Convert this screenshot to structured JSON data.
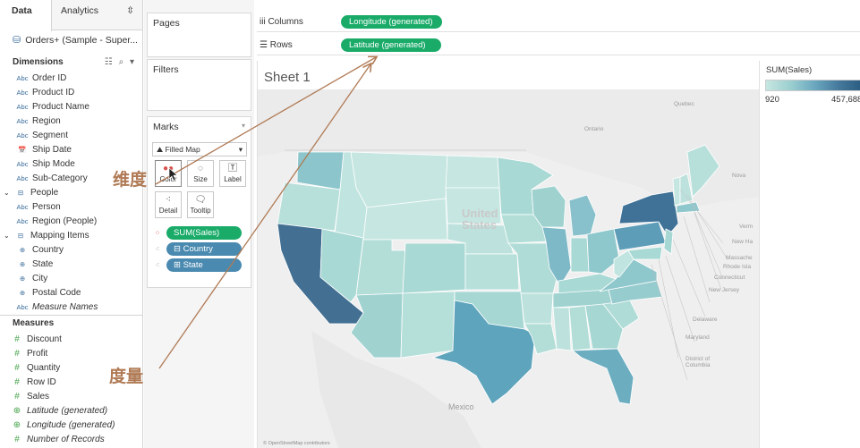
{
  "data_pane": {
    "tab_data": "Data",
    "tab_analytics": "Analytics",
    "tab_analytics_icon": "⇳",
    "datasource": "Orders+ (Sample - Super...",
    "dimensions_header": "Dimensions",
    "dimensions": [
      {
        "icon": "Abc",
        "label": "Order ID"
      },
      {
        "icon": "Abc",
        "label": "Product ID"
      },
      {
        "icon": "Abc",
        "label": "Product Name"
      },
      {
        "icon": "Abc",
        "label": "Region"
      },
      {
        "icon": "Abc",
        "label": "Segment"
      },
      {
        "icon": "📅",
        "label": "Ship Date"
      },
      {
        "icon": "Abc",
        "label": "Ship Mode"
      },
      {
        "icon": "Abc",
        "label": "Sub-Category"
      },
      {
        "icon": "⊟",
        "label": "People"
      },
      {
        "icon": "Abc",
        "label": "Person"
      },
      {
        "icon": "Abc",
        "label": "Region (People)"
      },
      {
        "icon": "⊟",
        "label": "Mapping Items"
      },
      {
        "icon": "⊕",
        "label": "Country"
      },
      {
        "icon": "⊕",
        "label": "State"
      },
      {
        "icon": "⊕",
        "label": "City"
      },
      {
        "icon": "⊕",
        "label": "Postal Code"
      },
      {
        "icon": "Abc",
        "label": "Measure Names"
      }
    ],
    "measures_header": "Measures",
    "measures": [
      {
        "icon": "#",
        "label": "Discount"
      },
      {
        "icon": "#",
        "label": "Profit"
      },
      {
        "icon": "#",
        "label": "Quantity"
      },
      {
        "icon": "#",
        "label": "Row ID"
      },
      {
        "icon": "#",
        "label": "Sales"
      },
      {
        "icon": "⊕",
        "label": "Latitude (generated)"
      },
      {
        "icon": "⊕",
        "label": "Longitude (generated)"
      },
      {
        "icon": "#",
        "label": "Number of Records"
      }
    ]
  },
  "shelves": {
    "pages": "Pages",
    "filters": "Filters",
    "marks": "Marks",
    "mark_type": "Filled Map",
    "mark_buttons": {
      "color": "Color",
      "size": "Size",
      "label": "Label",
      "detail": "Detail",
      "tooltip": "Tooltip"
    },
    "mark_pills": [
      {
        "label": "SUM(Sales)",
        "kind": "green"
      },
      {
        "label": "⊟ Country",
        "kind": "blue"
      },
      {
        "label": "⊞ State",
        "kind": "blue"
      }
    ],
    "columns_label": "Columns",
    "columns_pill": "Longitude (generated)",
    "rows_label": "Rows",
    "rows_pill": "Latitude (generated)"
  },
  "sheet": {
    "title": "Sheet 1",
    "labels": {
      "united_states": "United\nStates",
      "mexico": "Mexico",
      "quebec": "Quebec",
      "ontario": "Ontario",
      "nova": "Nova",
      "vermont": "Verm",
      "new_hampshire": "New Ha",
      "massachusetts": "Massache",
      "rhode_island": "Rhode Isla",
      "connecticut": "Connecticut",
      "new_jersey": "New Jersey",
      "delaware": "Delaware",
      "maryland": "Maryland",
      "dc": "District of\nColumbia"
    },
    "attribution": "© OpenStreetMap contributors"
  },
  "legend": {
    "title": "SUM(Sales)",
    "min": "920",
    "max": "457,688"
  },
  "annotations": {
    "dimension_note": "维度",
    "measure_note": "度量"
  },
  "colors": {
    "pill_green": "#1aab69",
    "pill_blue": "#4a8ab0",
    "annotation": "#b07a55",
    "map_low": "#c6e6e1",
    "map_high": "#2a5b80"
  }
}
